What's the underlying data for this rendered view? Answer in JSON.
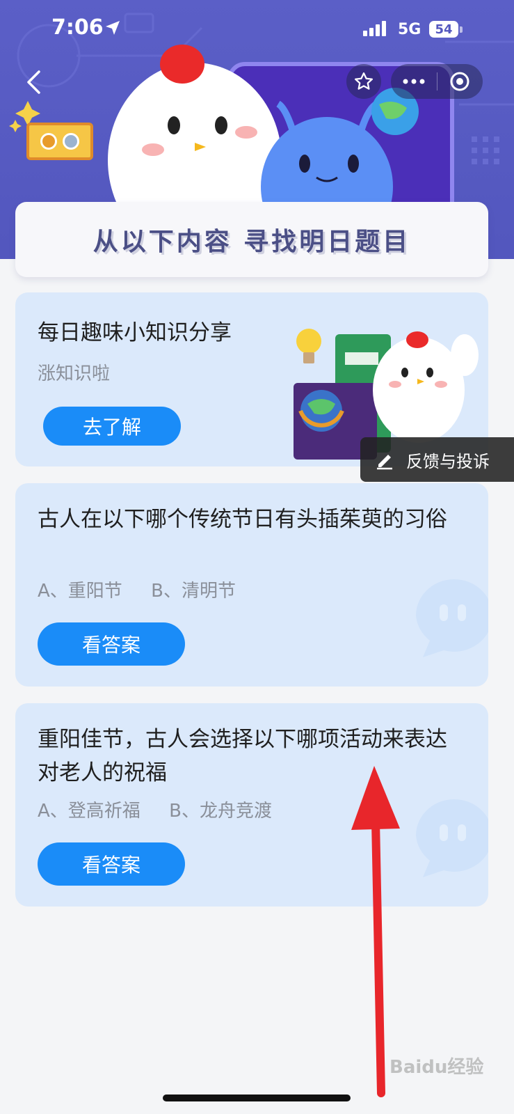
{
  "status_bar": {
    "time": "7:06",
    "network": "5G",
    "battery": "54"
  },
  "header": {
    "title": "从以下内容  寻找明日题目"
  },
  "cards": [
    {
      "title": "每日趣味小知识分享",
      "subtitle": "涨知识啦",
      "button_label": "去了解"
    },
    {
      "title": "古人在以下哪个传统节日有头插茱萸的习俗",
      "options": "A、重阳节     B、清明节",
      "button_label": "看答案"
    },
    {
      "title": "重阳佳节，古人会选择以下哪项活动来表达对老人的祝福",
      "options": "A、登高祈福     B、龙舟竞渡",
      "button_label": "看答案"
    }
  ],
  "feedback": {
    "label": "反馈与投诉"
  },
  "watermark": "Baidu经验",
  "colors": {
    "banner": "#5b5fc7",
    "card_bg": "#dbe9fb",
    "button": "#1a8cf8",
    "arrow": "#e8262b"
  },
  "icons": [
    "location-arrow-icon",
    "signal-icon",
    "back-chevron-icon",
    "star-icon",
    "more-icon",
    "close-circle-icon",
    "edit-icon",
    "chat-bubble-icon",
    "medal-icon"
  ]
}
